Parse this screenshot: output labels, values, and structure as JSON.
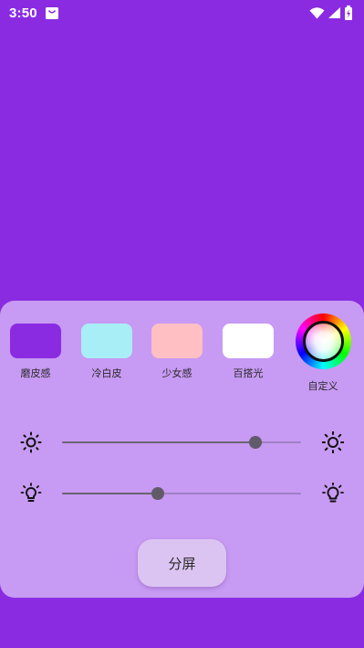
{
  "status_bar": {
    "time": "3:50",
    "icons": [
      "shopping-bag-icon",
      "wifi-icon",
      "signal-icon",
      "battery-charging-icon"
    ]
  },
  "colors": {
    "background": "#8a2be2",
    "panel": "#c79af3",
    "track_active": "#6b6372",
    "thumb": "#615a69"
  },
  "swatches": [
    {
      "label": "磨皮感",
      "color": "#8a2be2"
    },
    {
      "label": "冷白皮",
      "color": "#a8eef6"
    },
    {
      "label": "少女感",
      "color": "#ffbfc3"
    },
    {
      "label": "百搭光",
      "color": "#ffffff"
    }
  ],
  "custom": {
    "label": "自定义",
    "icon": "color-wheel-icon"
  },
  "sliders": [
    {
      "name": "brightness",
      "value_fraction": 0.81,
      "icon_left": "sun-small-icon",
      "icon_right": "sun-large-icon"
    },
    {
      "name": "light",
      "value_fraction": 0.4,
      "icon_left": "bulb-small-icon",
      "icon_right": "bulb-large-icon"
    }
  ],
  "split_button": {
    "label": "分屏"
  }
}
